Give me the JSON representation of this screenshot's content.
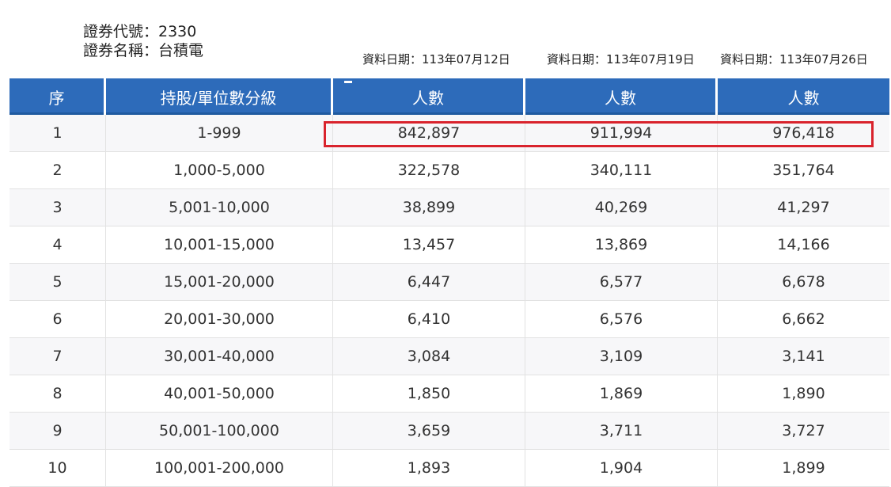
{
  "security": {
    "code_line": "證券代號：2330",
    "name_line": "證券名稱：台積電"
  },
  "dates": [
    "資料日期：113年07月12日",
    "資料日期：113年07月19日",
    "資料日期：113年07月26日"
  ],
  "table": {
    "headers": [
      "序",
      "持股/單位數分級",
      "人數",
      "人數",
      "人數"
    ],
    "rows": [
      [
        "1",
        "1-999",
        "842,897",
        "911,994",
        "976,418"
      ],
      [
        "2",
        "1,000-5,000",
        "322,578",
        "340,111",
        "351,764"
      ],
      [
        "3",
        "5,001-10,000",
        "38,899",
        "40,269",
        "41,297"
      ],
      [
        "4",
        "10,001-15,000",
        "13,457",
        "13,869",
        "14,166"
      ],
      [
        "5",
        "15,001-20,000",
        "6,447",
        "6,577",
        "6,678"
      ],
      [
        "6",
        "20,001-30,000",
        "6,410",
        "6,576",
        "6,662"
      ],
      [
        "7",
        "30,001-40,000",
        "3,084",
        "3,109",
        "3,141"
      ],
      [
        "8",
        "40,001-50,000",
        "1,850",
        "1,869",
        "1,890"
      ],
      [
        "9",
        "50,001-100,000",
        "3,659",
        "3,711",
        "3,727"
      ],
      [
        "10",
        "100,001-200,000",
        "1,893",
        "1,904",
        "1,899"
      ]
    ]
  },
  "colors": {
    "header_bg": "#2d6bba",
    "highlight": "#d9232d"
  }
}
